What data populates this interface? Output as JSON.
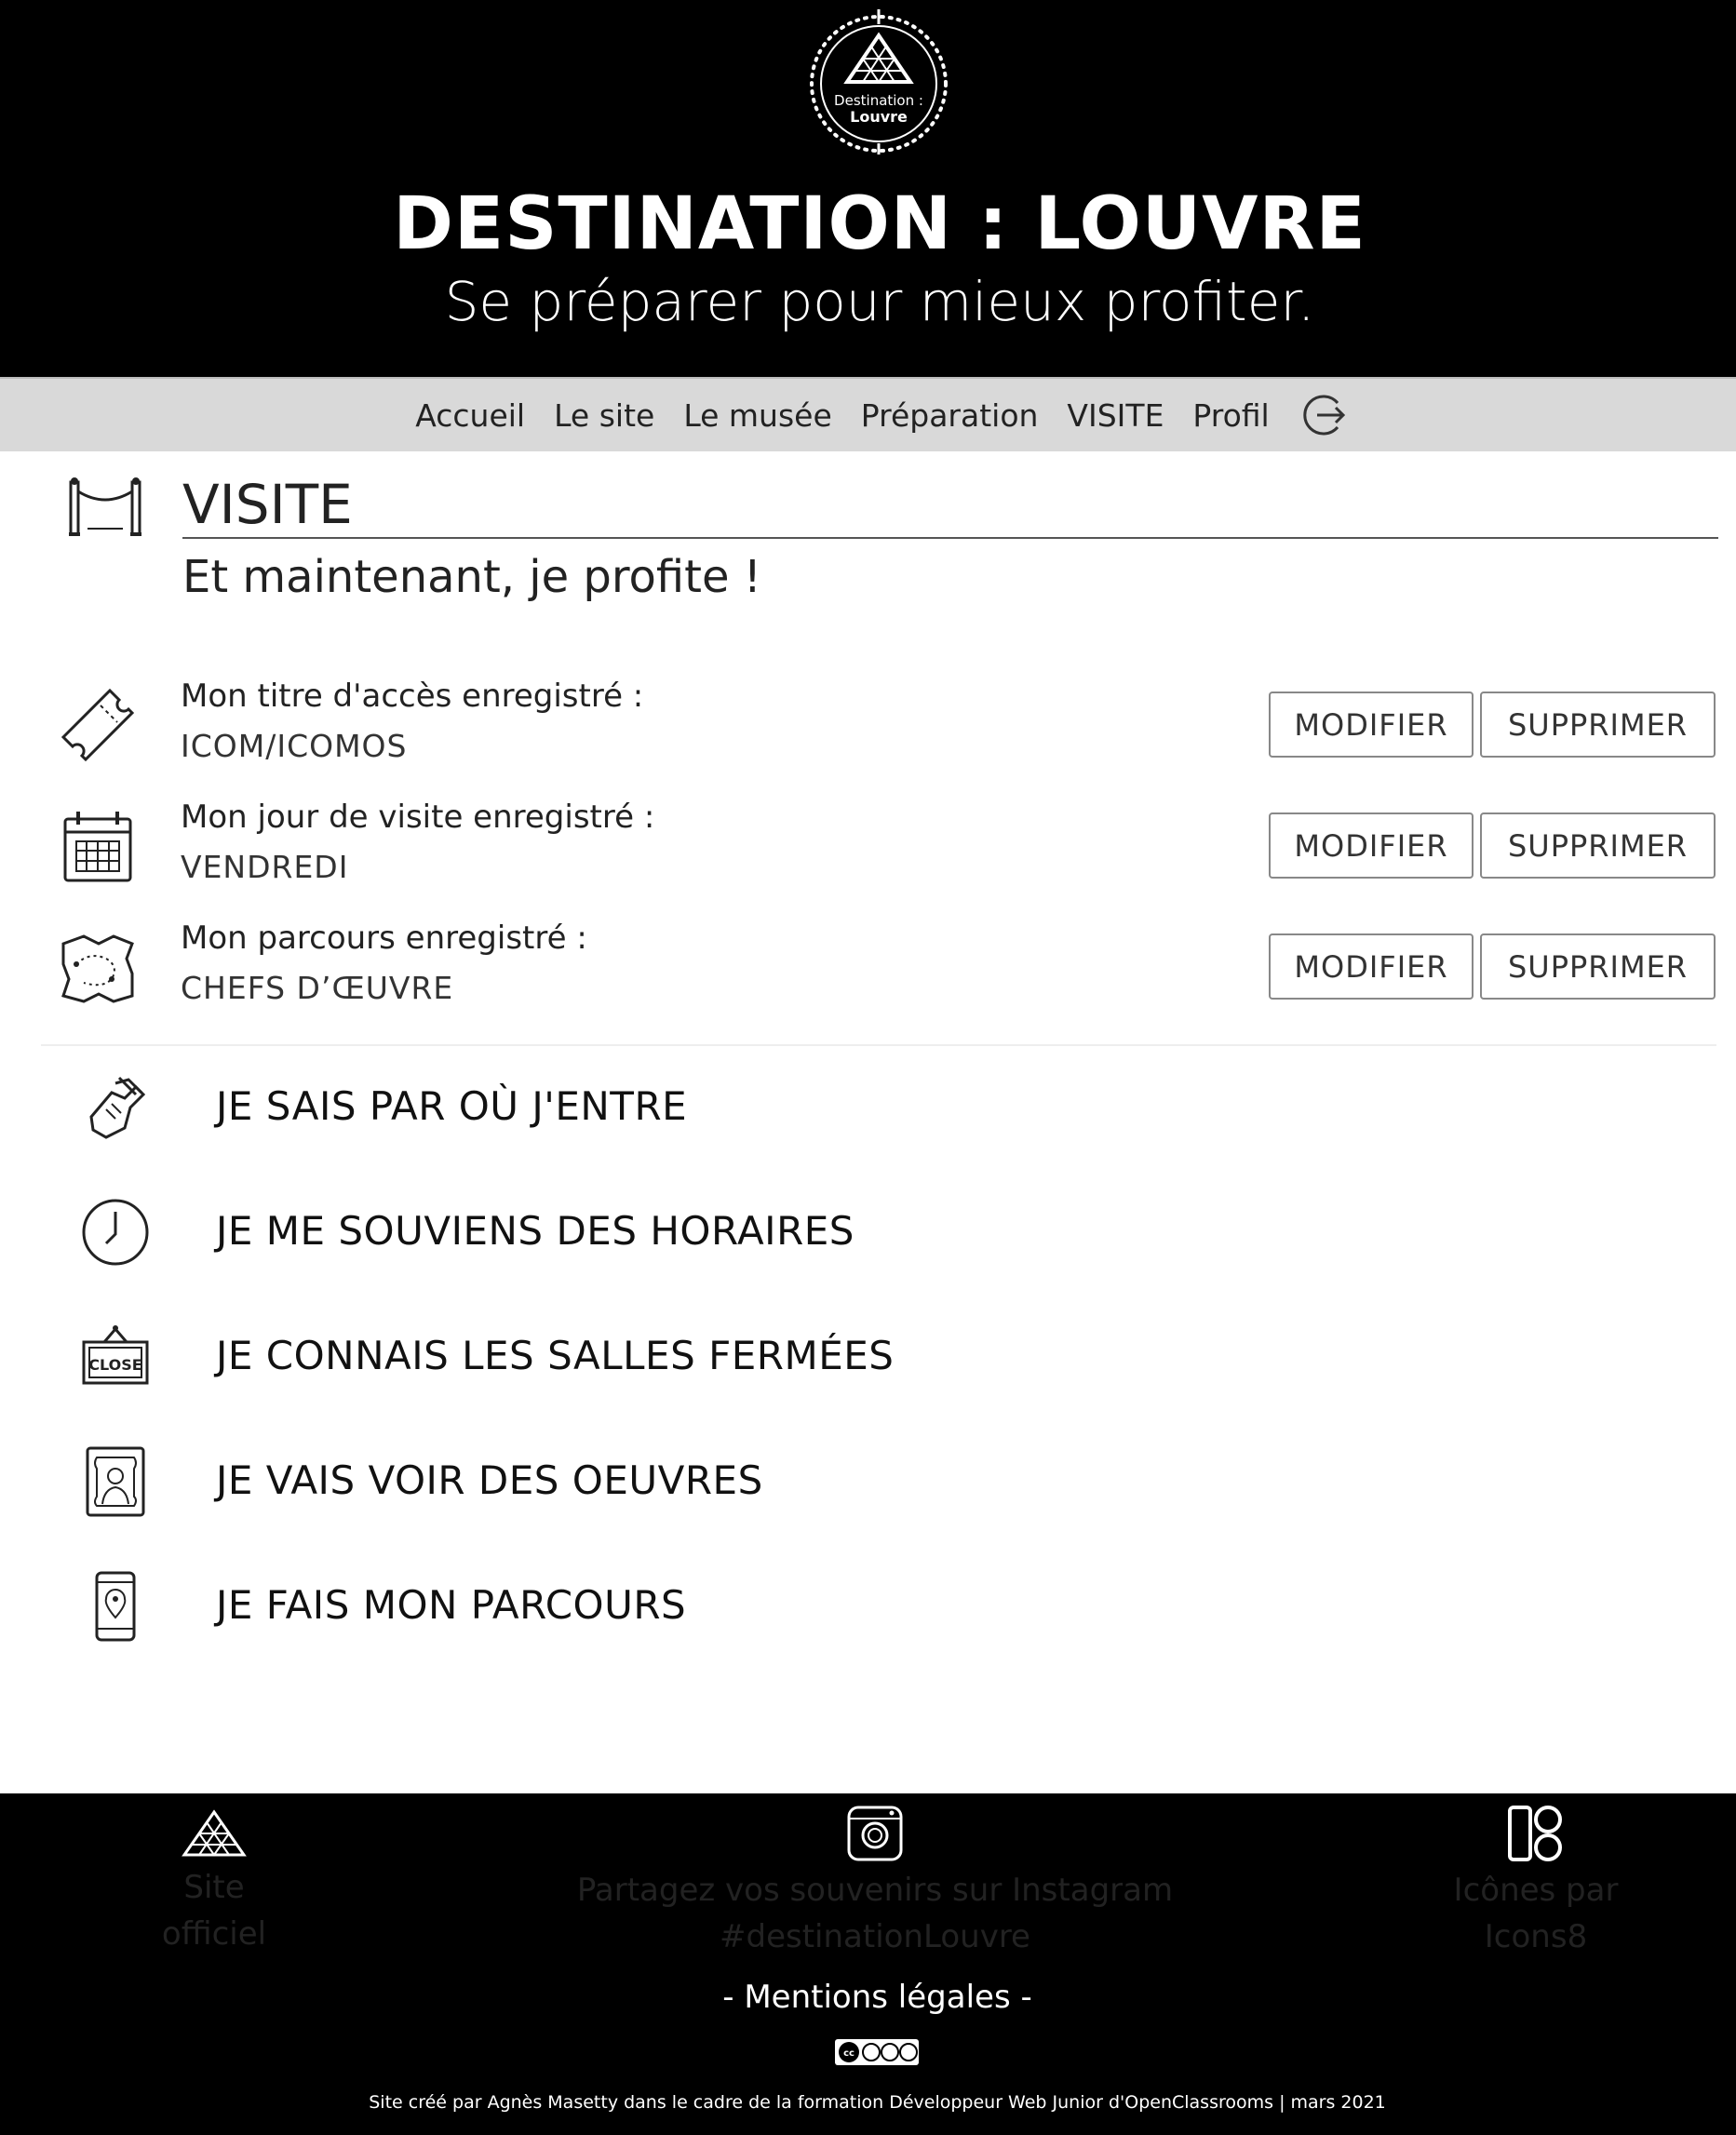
{
  "header": {
    "logo_line1": "Destination :",
    "logo_line2": "Louvre",
    "title": "DESTINATION : LOUVRE",
    "subtitle": "Se préparer pour mieux profiter."
  },
  "nav": {
    "items": [
      "Accueil",
      "Le site",
      "Le musée",
      "Préparation",
      "VISITE",
      "Profil"
    ],
    "logout_icon": "logout-icon"
  },
  "section": {
    "icon": "museum-rope-icon",
    "title": "VISITE",
    "subtitle": "Et maintenant, je profite !"
  },
  "records": [
    {
      "icon": "ticket-icon",
      "label": "Mon titre d'accès enregistré :",
      "value": "ICOM/ICOMOS",
      "modify": "MODIFIER",
      "delete": "SUPPRIMER"
    },
    {
      "icon": "calendar-icon",
      "label": "Mon jour de visite enregistré :",
      "value": "VENDREDI",
      "modify": "MODIFIER",
      "delete": "SUPPRIMER"
    },
    {
      "icon": "map-route-icon",
      "label": "Mon parcours enregistré :",
      "value": "CHEFS D’ŒUVRE",
      "modify": "MODIFIER",
      "delete": "SUPPRIMER"
    }
  ],
  "actions": [
    {
      "icon": "hand-ticket-icon",
      "label": "JE SAIS PAR OÙ J'ENTRE"
    },
    {
      "icon": "clock-icon",
      "label": "JE ME SOUVIENS DES HORAIRES"
    },
    {
      "icon": "close-sign-icon",
      "label": "JE CONNAIS LES SALLES FERMÉES",
      "sign_text": "CLOSE"
    },
    {
      "icon": "portrait-frame-icon",
      "label": "JE VAIS VOIR DES OEUVRES"
    },
    {
      "icon": "phone-location-icon",
      "label": "JE FAIS MON PARCOURS"
    }
  ],
  "footer": {
    "official": {
      "icon": "louvre-pyramid-icon",
      "line1": "Site",
      "line2": "officiel"
    },
    "instagram": {
      "icon": "instagram-icon",
      "line1": "Partagez vos souvenirs sur Instagram",
      "line2": "#destinationLouvre"
    },
    "icons8": {
      "icon": "icons8-icon",
      "line1": "Icônes par",
      "line2": "Icons8"
    },
    "mentions": "- Mentions légales -",
    "license_icon": "creative-commons-icon",
    "credits": "Site créé par Agnès Masetty dans le cadre de la formation Développeur Web Junior d'OpenClassrooms | mars 2021"
  },
  "colors": {
    "header_bg": "#000000",
    "nav_bg": "#d9d9d9",
    "text": "#222222",
    "button_border": "#888888"
  }
}
